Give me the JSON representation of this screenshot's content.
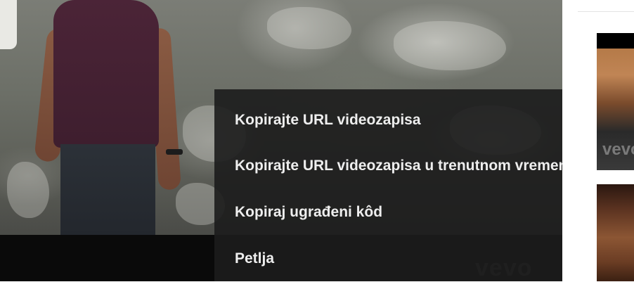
{
  "player": {
    "watermark": "vevo"
  },
  "context_menu": {
    "items": [
      {
        "label": "Kopirajte URL videozapisa"
      },
      {
        "label": "Kopirajte URL videozapisa u trenutnom vremenu"
      },
      {
        "label": "Kopiraj ugrađeni kôd"
      },
      {
        "label": "Petlja"
      }
    ]
  },
  "sidebar": {
    "thumbnails": [
      {
        "watermark": "vevo"
      },
      {
        "watermark": ""
      }
    ]
  },
  "colors": {
    "menu_background": "#1c1c1c",
    "menu_text": "#eeeeee",
    "shirt": "#4b2437"
  }
}
